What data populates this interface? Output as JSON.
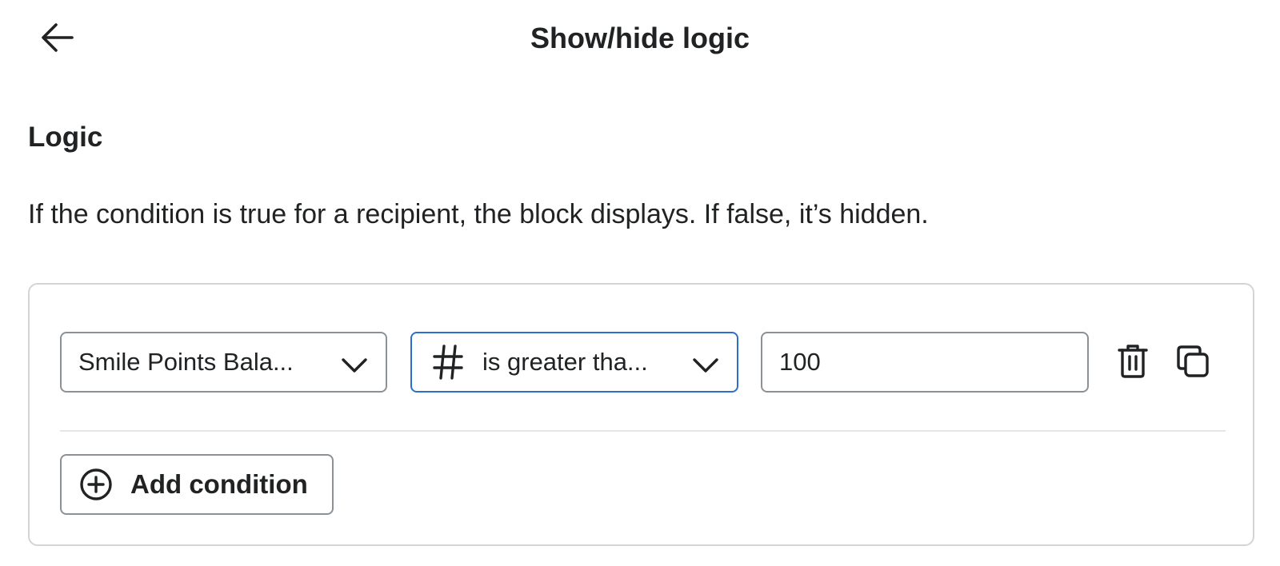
{
  "header": {
    "title": "Show/hide logic",
    "back_icon": "arrow-left-icon"
  },
  "section": {
    "title": "Logic",
    "description": "If the condition is true for a recipient, the block displays. If false, it’s hidden."
  },
  "condition": {
    "property": "Smile Points Bala...",
    "operator_icon": "hash-icon",
    "operator": "is greater tha...",
    "value": "100"
  },
  "actions": {
    "delete_icon": "trash-icon",
    "duplicate_icon": "duplicate-icon"
  },
  "add_condition": {
    "label": "Add condition",
    "icon": "plus-circle-icon"
  },
  "colors": {
    "focus_border": "#2c6ecb",
    "field_border": "#8c9196",
    "card_border": "#d2d5d8",
    "text": "#202223"
  }
}
